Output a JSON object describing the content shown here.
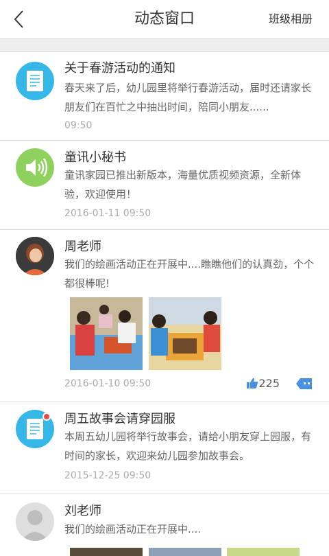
{
  "header": {
    "title": "动态窗口",
    "right_action": "班级相册"
  },
  "feed": [
    {
      "type": "notice",
      "name": "关于春游活动的通知",
      "content": "春天来了后，幼儿园里将举行春游活动，届时还请家长朋友们在百忙之中抽出时间，陪同小朋友......",
      "time": "09:50",
      "icon": "document-icon",
      "accent": "#35b8e8"
    },
    {
      "type": "system",
      "name": "童讯小秘书",
      "content": "童讯家园已推出新版本，海量优质视频资源，全新体验，欢迎使用！",
      "time": "2016-01-11 09:50",
      "icon": "speaker-icon",
      "accent": "#8fd15e"
    },
    {
      "type": "post",
      "name": "周老师",
      "content": "我们的绘画活动正在开展中....瞧瞧他们的认真劲，个个都很棒呢!",
      "time": "2016-01-10 09:50",
      "likes": "225",
      "icon": "teacher-avatar"
    },
    {
      "type": "notice",
      "name": "周五故事会请穿园服",
      "content": "本周五幼儿园将举行故事会，请给小朋友穿上园服，有时间的家长，欢迎来幼儿园参加故事会。",
      "time": "2015-12-25 09:50",
      "icon": "document-icon",
      "unread": true
    },
    {
      "type": "post",
      "name": "刘老师",
      "content": "我们的绘画活动正在开展中....",
      "icon": "default-avatar"
    }
  ],
  "colors": {
    "accent_blue": "#35b8e8",
    "accent_green": "#8fd15e",
    "like_blue": "#4a90e2"
  }
}
